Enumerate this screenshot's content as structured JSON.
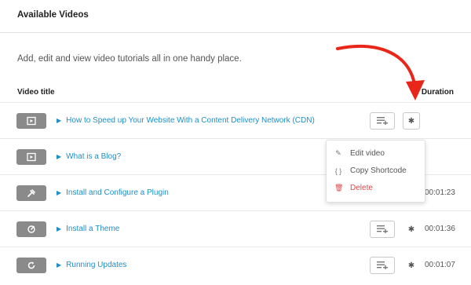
{
  "header": {
    "title": "Available Videos"
  },
  "description": "Add, edit and view video tutorials all in one handy place.",
  "table": {
    "col_title": "Video title",
    "col_duration": "Duration",
    "rows": [
      {
        "title": "How to Speed up Your Website With a Content Delivery Network (CDN)",
        "duration": "",
        "thumb_icon": "play-box-icon"
      },
      {
        "title": "What is a Blog?",
        "duration": "",
        "thumb_icon": "play-box-icon"
      },
      {
        "title": "Install and Configure a Plugin",
        "duration": "00:01:23",
        "thumb_icon": "plugin-icon"
      },
      {
        "title": "Install a Theme",
        "duration": "00:01:36",
        "thumb_icon": "theme-brush-icon"
      },
      {
        "title": "Running Updates",
        "duration": "00:01:07",
        "thumb_icon": "refresh-icon"
      }
    ]
  },
  "dropdown": {
    "edit": "Edit video",
    "copy": "Copy Shortcode",
    "delete": "Delete"
  },
  "colors": {
    "link": "#1e8fc6",
    "delete": "#e04848",
    "arrow": "#e8271a"
  }
}
